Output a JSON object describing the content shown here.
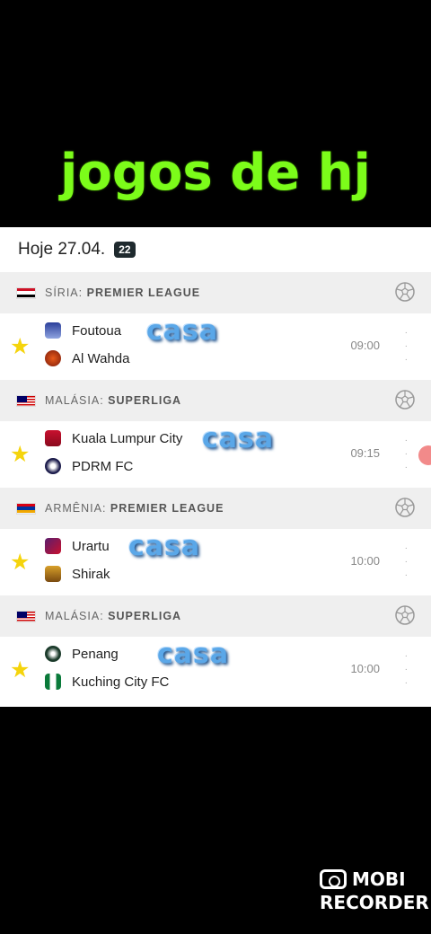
{
  "overlay_title": "jogos de hj",
  "date_header": {
    "label": "Hoje 27.04.",
    "count": "22"
  },
  "leagues": [
    {
      "country": "SÍRIA",
      "name": "PREMIER LEAGUE",
      "match": {
        "home": "Foutoua",
        "away": "Al Wahda",
        "time": "09:00",
        "note": "casa"
      }
    },
    {
      "country": "MALÁSIA",
      "name": "SUPERLIGA",
      "match": {
        "home": "Kuala Lumpur City",
        "away": "PDRM FC",
        "time": "09:15",
        "note": "casa"
      }
    },
    {
      "country": "ARMÊNIA",
      "name": "PREMIER LEAGUE",
      "match": {
        "home": "Urartu",
        "away": "Shirak",
        "time": "10:00",
        "note": "casa"
      }
    },
    {
      "country": "MALÁSIA",
      "name": "SUPERLIGA",
      "match": {
        "home": "Penang",
        "away": "Kuching City FC",
        "time": "10:00",
        "note": "casa"
      }
    }
  ],
  "recorder": {
    "line1": "MOBI",
    "line2": "RECORDER"
  },
  "colors": {
    "overlay": "#7CFC1A",
    "star": "#f5d40c",
    "casa": "#5aa7e8"
  }
}
